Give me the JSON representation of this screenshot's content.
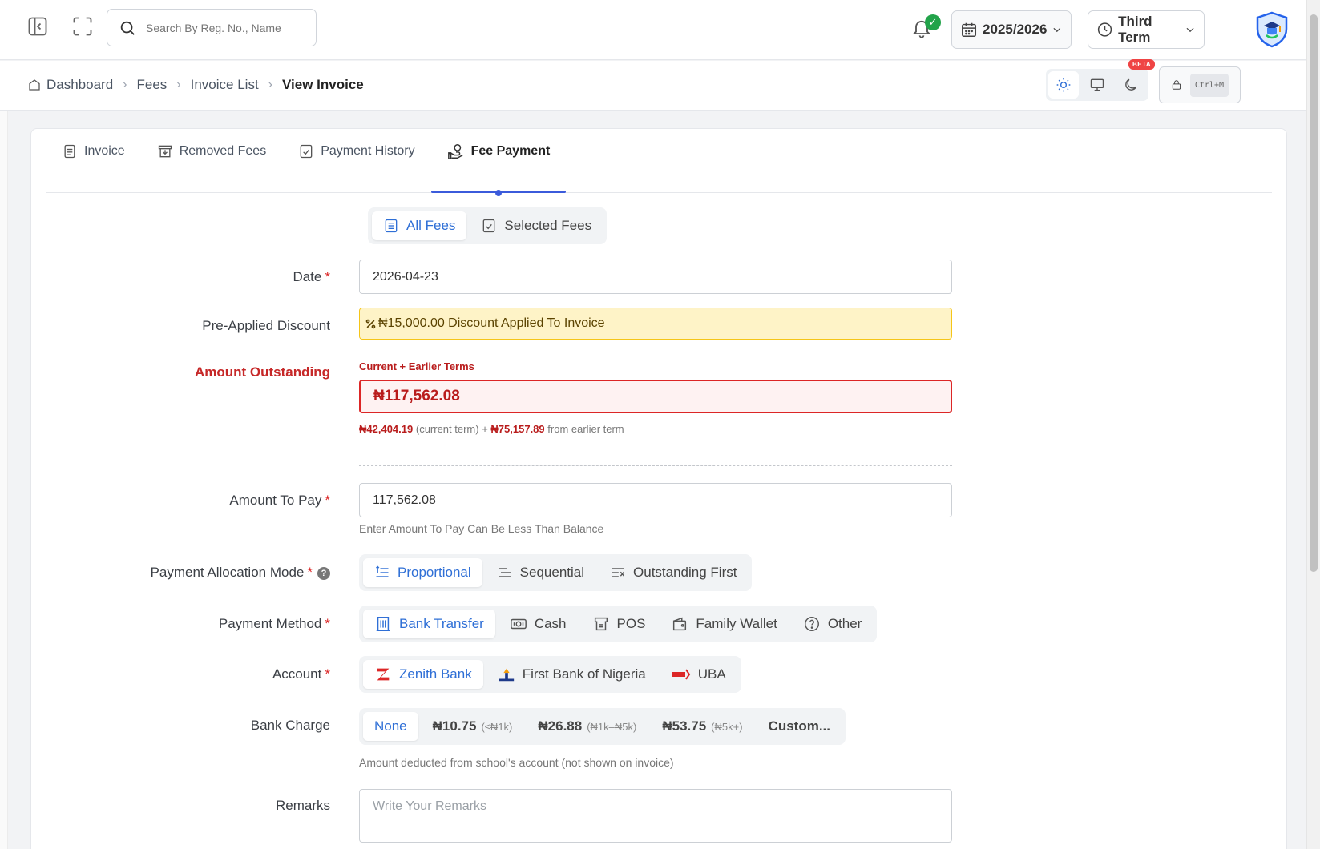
{
  "topbar": {
    "search_placeholder": "Search By Reg. No., Name",
    "session": "2025/2026",
    "term": "Third Term",
    "bell_badge": "✓"
  },
  "breadcrumb": {
    "items": [
      "Dashboard",
      "Fees",
      "Invoice List",
      "View Invoice"
    ]
  },
  "theme": {
    "beta_label": "BETA",
    "lock_shortcut": "Ctrl+M"
  },
  "tabs": [
    "Invoice",
    "Removed Fees",
    "Payment History",
    "Fee Payment"
  ],
  "fee_scope": {
    "all": "All Fees",
    "selected": "Selected Fees"
  },
  "form": {
    "date_label": "Date",
    "date_value": "2026-04-23",
    "discount_label": "Pre-Applied Discount",
    "discount_value": "₦15,000.00 Discount Applied To Invoice",
    "outstanding_label": "Amount Outstanding",
    "outstanding_caption": "Current + Earlier Terms",
    "outstanding_value": "₦117,562.08",
    "outstanding_current": "₦42,404.19",
    "outstanding_current_text": "(current term) +",
    "outstanding_earlier": "₦75,157.89",
    "outstanding_earlier_text": "from earlier term",
    "amount_label": "Amount To Pay",
    "amount_value": "117,562.08",
    "amount_help": "Enter Amount To Pay Can Be Less Than Balance",
    "allocation_label": "Payment Allocation Mode",
    "allocation_options": [
      "Proportional",
      "Sequential",
      "Outstanding First"
    ],
    "method_label": "Payment Method",
    "method_options": [
      "Bank Transfer",
      "Cash",
      "POS",
      "Family Wallet",
      "Other"
    ],
    "account_label": "Account",
    "account_options": [
      "Zenith Bank",
      "First Bank of Nigeria",
      "UBA"
    ],
    "charge_label": "Bank Charge",
    "charge_options": [
      {
        "main": "None",
        "sub": ""
      },
      {
        "main": "₦10.75",
        "sub": "(≤₦1k)"
      },
      {
        "main": "₦26.88",
        "sub": "(₦1k–₦5k)"
      },
      {
        "main": "₦53.75",
        "sub": "(₦5k+)"
      },
      {
        "main": "Custom...",
        "sub": ""
      }
    ],
    "charge_help": "Amount deducted from school's account (not shown on invoice)",
    "remarks_label": "Remarks",
    "remarks_placeholder": "Write Your Remarks"
  },
  "colors": {
    "accent": "#2f6fd6",
    "danger": "#dc2626",
    "warning_bg": "#fef3c7"
  }
}
